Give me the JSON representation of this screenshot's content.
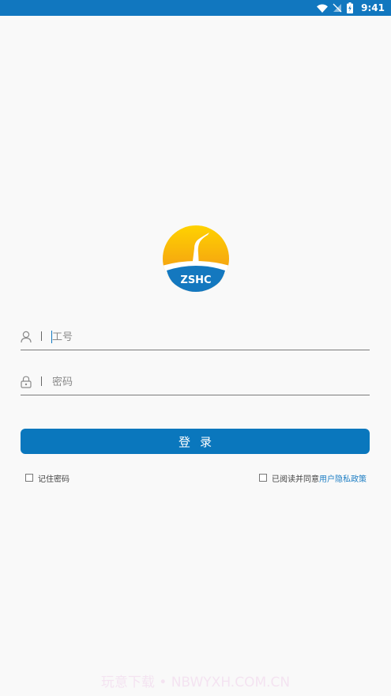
{
  "status_bar": {
    "time": "9:41",
    "background": "#1177bf",
    "icons": [
      "wifi-icon",
      "no-signal-icon",
      "battery-charging-icon"
    ]
  },
  "logo": {
    "text": "ZSHC",
    "colors": {
      "sun_top": "#ffd300",
      "sun_bottom": "#f08a1a",
      "band": "#1478bf"
    }
  },
  "form": {
    "employee_id": {
      "placeholder": "工号",
      "value": "",
      "icon": "user-icon"
    },
    "password": {
      "placeholder": "密码",
      "value": "",
      "icon": "lock-icon"
    },
    "login_label": "登录",
    "remember_label": "记住密码",
    "agree_prefix": "已阅读并同意",
    "privacy_link": "用户隐私政策"
  },
  "accent_color": "#0a77bd",
  "watermark": "玩意下载 • NBWYXH.COM.CN"
}
